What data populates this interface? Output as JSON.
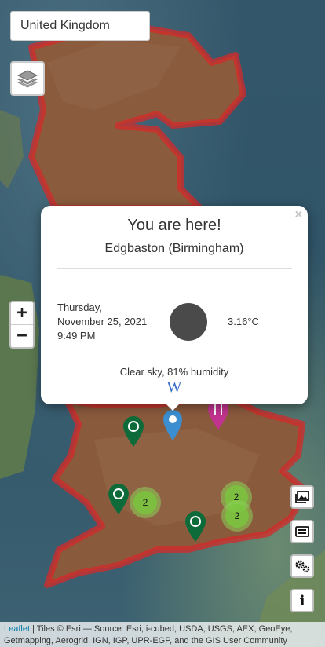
{
  "country_select": {
    "value": "United Kingdom"
  },
  "zoom": {
    "in_label": "+",
    "out_label": "−"
  },
  "popup": {
    "close_label": "×",
    "title": "You are here!",
    "place": "Edgbaston (Birmingham)",
    "day": "Thursday,",
    "date": "November 25, 2021",
    "time": "9:49 PM",
    "temperature": "3.16°C",
    "description": "Clear sky, 81% humidity",
    "wiki_label": "W"
  },
  "markers": {
    "hiking_color": "#0d6b3a",
    "location_color": "#3b8fd1",
    "food_color": "#c2338f"
  },
  "clusters": [
    {
      "count": "2"
    },
    {
      "count": "2"
    },
    {
      "count": "2"
    }
  ],
  "side_buttons": {
    "info_label": "i"
  },
  "attribution": {
    "link": "Leaflet",
    "text": " | Tiles © Esri — Source: Esri, i-cubed, USDA, USGS, AEX, GeoEye, Getmapping, Aerogrid, IGN, IGP, UPR-EGP, and the GIS User Community"
  },
  "colors": {
    "border_red": "#d42a2a",
    "land": "#8a5a3c"
  }
}
